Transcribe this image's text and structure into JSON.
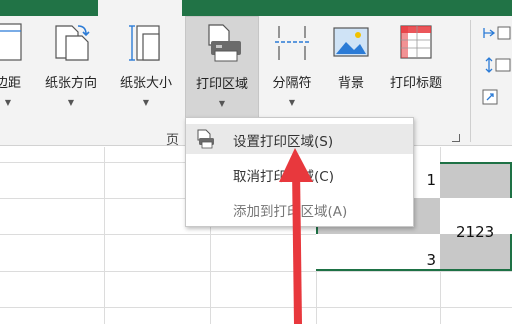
{
  "ribbon": {
    "buttons": [
      {
        "label": "边距",
        "icon": "margins-icon"
      },
      {
        "label": "纸张方向",
        "icon": "orientation-icon"
      },
      {
        "label": "纸张大小",
        "icon": "paper-size-icon"
      },
      {
        "label": "打印区域",
        "icon": "print-area-icon"
      },
      {
        "label": "分隔符",
        "icon": "breaks-icon"
      },
      {
        "label": "背景",
        "icon": "background-icon"
      },
      {
        "label": "打印标题",
        "icon": "print-titles-icon"
      }
    ],
    "group_label": "页"
  },
  "menu": {
    "items": [
      {
        "label": "设置打印区域(S)",
        "icon": "set-print-area-icon"
      },
      {
        "label": "取消打印区域(C)"
      },
      {
        "label": "添加到打印区域(A)"
      }
    ]
  },
  "sheet": {
    "cells": [
      "1",
      "2123",
      "3"
    ]
  },
  "colors": {
    "accent": "#217346",
    "selection_border": "#1e7145",
    "arrow": "#e8383d"
  }
}
